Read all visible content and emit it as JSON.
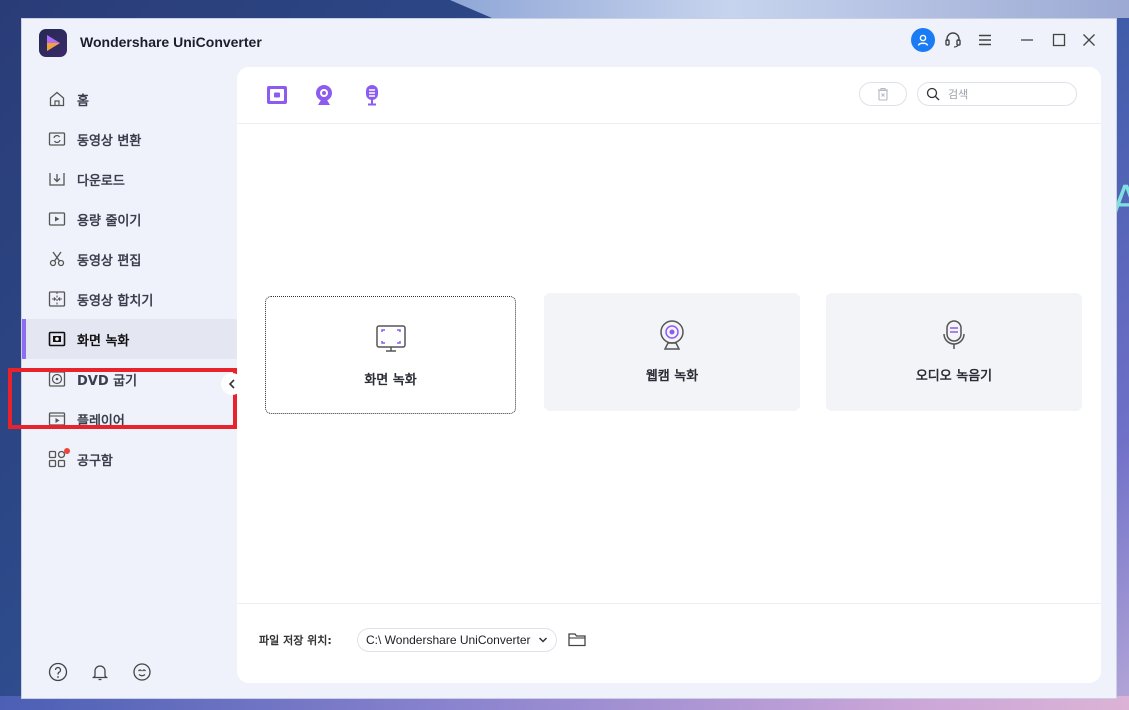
{
  "app": {
    "title": "Wondershare UniConverter"
  },
  "titlebar": {
    "icons": [
      "user-icon",
      "headset-icon",
      "menu-icon",
      "minimize-icon",
      "maximize-icon",
      "close-icon"
    ],
    "accent_color": "#1a7cf5"
  },
  "sidebar": {
    "items": [
      {
        "label": "홈",
        "icon": "home-icon"
      },
      {
        "label": "동영상 변환",
        "icon": "convert-icon"
      },
      {
        "label": "다운로드",
        "icon": "download-icon"
      },
      {
        "label": "용량 줄이기",
        "icon": "compress-icon"
      },
      {
        "label": "동영상 편집",
        "icon": "scissors-icon"
      },
      {
        "label": "동영상 합치기",
        "icon": "merge-icon"
      },
      {
        "label": "화면 녹화",
        "icon": "screen-record-icon",
        "active": true
      },
      {
        "label": "DVD 굽기",
        "icon": "dvd-icon"
      },
      {
        "label": "플레이어",
        "icon": "player-icon"
      },
      {
        "label": "공구함",
        "icon": "toolbox-icon"
      }
    ],
    "active_color": "#8d6df0",
    "highlight_color": "#e8232b",
    "bottom_icons": [
      "help-icon",
      "bell-icon",
      "feedback-icon"
    ]
  },
  "toolbar": {
    "tabs": [
      "screen-record-tab-icon",
      "webcam-tab-icon",
      "mic-tab-icon"
    ],
    "accent_color": "#8d5bf0",
    "search_placeholder": "검색"
  },
  "cards": [
    {
      "label": "화면 녹화",
      "icon": "screen-record-icon",
      "selected": true
    },
    {
      "label": "웹캠 녹화",
      "icon": "webcam-icon"
    },
    {
      "label": "오디오 녹음기",
      "icon": "microphone-icon"
    }
  ],
  "footer": {
    "save_label": "파일 저장 위치:",
    "path_value": "C:\\ Wondershare UniConverter"
  }
}
